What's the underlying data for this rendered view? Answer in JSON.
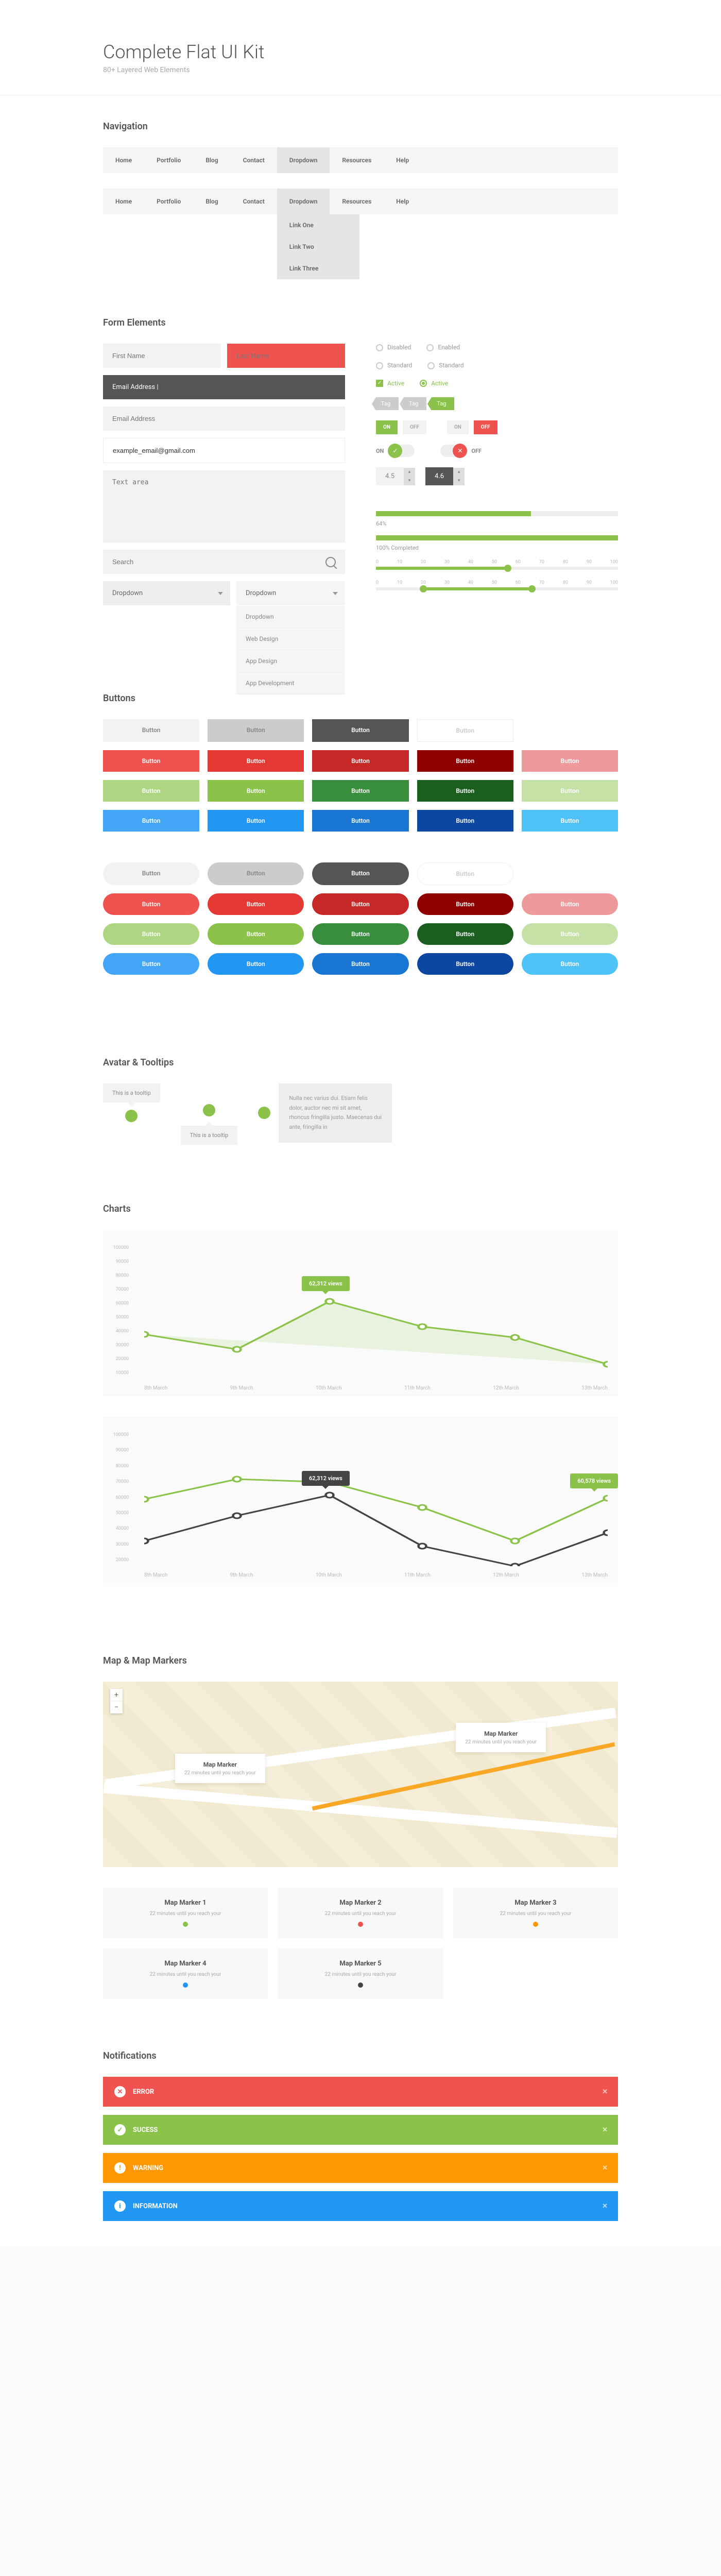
{
  "header": {
    "title": "Complete Flat UI Kit",
    "subtitle": "80+ Layered Web Elements"
  },
  "sections": {
    "nav": "Navigation",
    "form": "Form Elements",
    "buttons": "Buttons",
    "avatar": "Avatar & Tooltips",
    "charts": "Charts",
    "map": "Map & Map Markers",
    "notif": "Notifications"
  },
  "nav": {
    "items": [
      "Home",
      "Portfolio",
      "Blog",
      "Contact",
      "Dropdown",
      "Resources",
      "Help"
    ],
    "dropdown": [
      "Link One",
      "Link Two",
      "Link Three"
    ]
  },
  "form": {
    "first_name": "First Name",
    "last_name": "Last Name",
    "email_focused": "Email Address |",
    "email_ph": "Email Address",
    "email_val": "example_email@gmail.com",
    "textarea": "Text area",
    "search": "Search",
    "dropdown": "Dropdown",
    "dd_items": [
      "Dropdown",
      "Web Design",
      "App Design",
      "App Development"
    ],
    "disabled": "Disabled",
    "enabled": "Enabled",
    "standard": "Standard",
    "active": "Active",
    "tag": "Tag",
    "on": "ON",
    "off": "OFF",
    "step1": "4.5",
    "step2": "4.6",
    "prog1": "64%",
    "prog2": "100% Completed",
    "ruler": [
      "0",
      "10",
      "20",
      "30",
      "40",
      "50",
      "60",
      "70",
      "80",
      "90",
      "100"
    ]
  },
  "buttons": {
    "label": "Button"
  },
  "tooltip": {
    "short": "This is a tooltip",
    "long": "Nulla nec varius dui. Etiam felis dolor, auctor nec mi sit amet, rhoncus fringilla justo. Maecenas dui ante, fringilla in"
  },
  "chart_data": [
    {
      "type": "line",
      "title": "",
      "ylabel": "",
      "xlabel": "",
      "categories": [
        "8th March",
        "9th March",
        "10th March",
        "11th March",
        "12th March",
        "13th March"
      ],
      "y_ticks": [
        100000,
        90000,
        80000,
        70000,
        60000,
        50000,
        40000,
        30000,
        20000,
        10000
      ],
      "series": [
        {
          "name": "views",
          "values": [
            40000,
            30000,
            62312,
            45000,
            38000,
            20000
          ]
        }
      ],
      "annotation": {
        "index": 2,
        "label": "62,312 views"
      },
      "ylim": [
        10000,
        100000
      ]
    },
    {
      "type": "line",
      "title": "",
      "ylabel": "",
      "xlabel": "",
      "categories": [
        "8th March",
        "9th March",
        "10th March",
        "11th March",
        "12th March",
        "13th March"
      ],
      "y_ticks": [
        100000,
        90000,
        80000,
        70000,
        60000,
        50000,
        40000,
        30000,
        20000
      ],
      "series": [
        {
          "name": "green",
          "values": [
            60000,
            72000,
            70000,
            55000,
            35000,
            60578
          ]
        },
        {
          "name": "dark",
          "values": [
            35000,
            50000,
            62312,
            32000,
            20000,
            40000
          ]
        }
      ],
      "annotations": [
        {
          "series": 1,
          "index": 2,
          "label": "62,312 views",
          "style": "dark"
        },
        {
          "series": 0,
          "index": 5,
          "label": "60,578 views",
          "style": "green"
        }
      ],
      "ylim": [
        20000,
        100000
      ]
    }
  ],
  "map": {
    "marker_title": "Map Marker",
    "marker_sub": "22 minutes until you reach your",
    "cards": [
      {
        "title": "Map Marker 1",
        "sub": "22 minutes until you reach your",
        "color": "#8bc34a"
      },
      {
        "title": "Map Marker 2",
        "sub": "22 minutes until you reach your",
        "color": "#ef5350"
      },
      {
        "title": "Map Marker 3",
        "sub": "22 minutes until you reach your",
        "color": "#ff9800"
      },
      {
        "title": "Map Marker 4",
        "sub": "22 minutes until you reach your",
        "color": "#2196f3"
      },
      {
        "title": "Map Marker 5",
        "sub": "22 minutes until you reach your",
        "color": "#444"
      }
    ]
  },
  "notif": {
    "error": "ERROR",
    "success": "SUCESS",
    "warning": "WARNING",
    "info": "INFORMATION"
  }
}
